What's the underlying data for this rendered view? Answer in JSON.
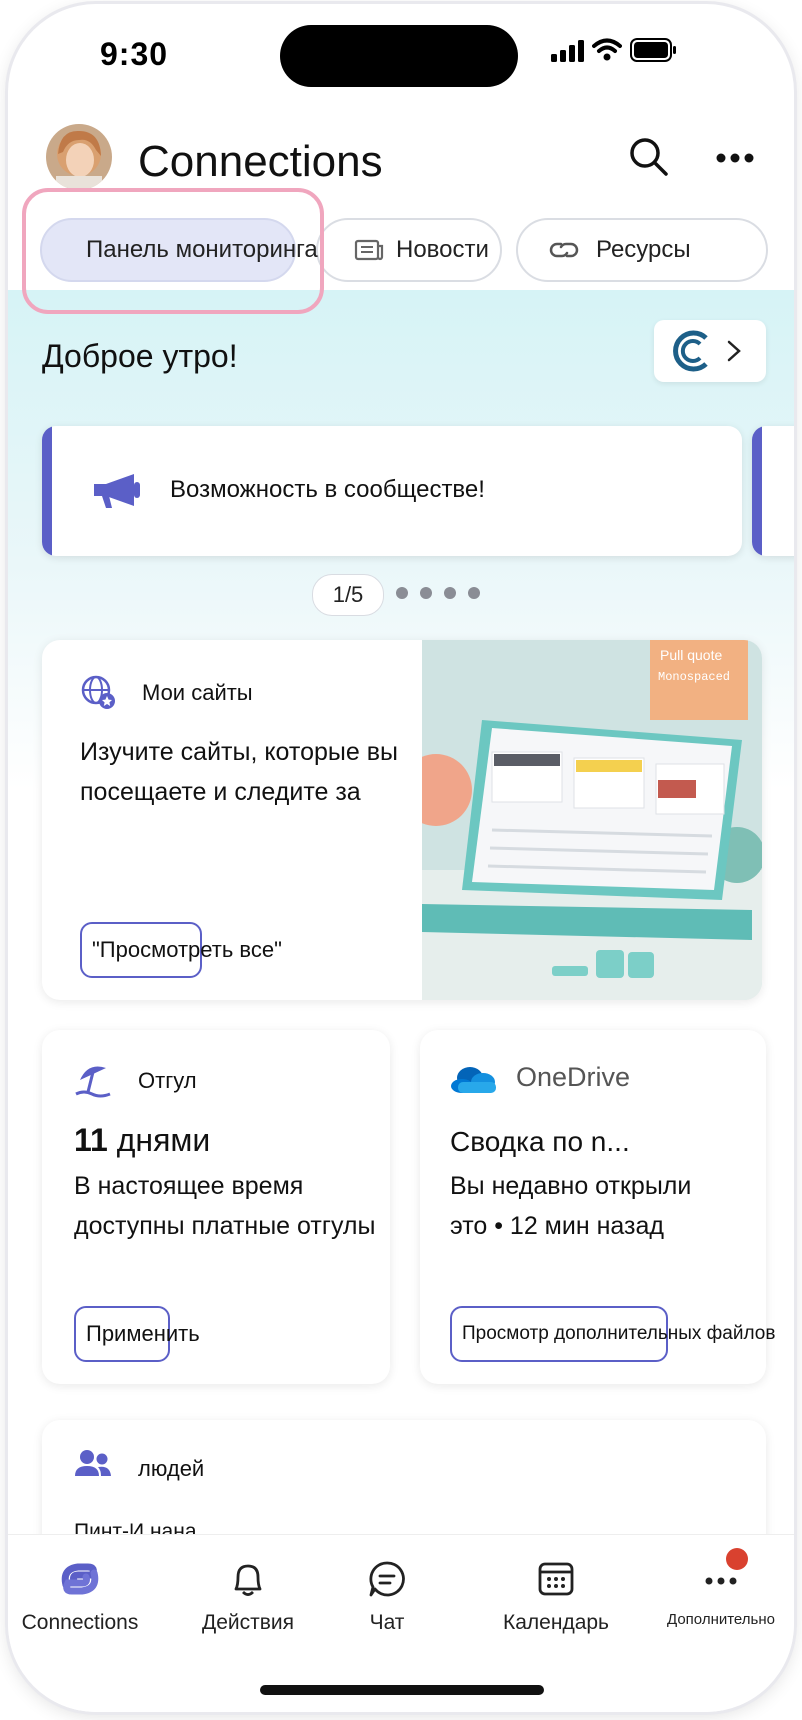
{
  "status_bar": {
    "time": "9:30"
  },
  "header": {
    "app_title": "Connections"
  },
  "tabs": [
    {
      "label": "Панель мониторинга",
      "active": true
    },
    {
      "label": "Новости",
      "active": false
    },
    {
      "label": "Ресурсы",
      "active": false
    }
  ],
  "greeting": "Доброе утро!",
  "announcement": {
    "text": "Возможность в сообществе!",
    "pager": "1/5",
    "accent": "#5b5fc7"
  },
  "my_sites": {
    "title": "Мои сайты",
    "description": "Изучите сайты, которые вы посещаете и следите за",
    "button": "\"Просмотреть все\"",
    "image_labels": {
      "pull_quote": "Pull quote",
      "monospaced": "Monospaced"
    }
  },
  "time_off": {
    "title": "Отгул",
    "count": "11",
    "unit": "днями",
    "description": "В настоящее время доступны платные отгулы",
    "button": "Применить"
  },
  "onedrive": {
    "title": "OneDrive",
    "heading": "Сводка по n...",
    "description": "Вы недавно открыли это • 12 мин назад",
    "button": "Просмотр дополнительных файлов"
  },
  "people": {
    "title": "людей",
    "subtitle": "Пинт-И нана"
  },
  "bottom_nav": [
    {
      "label": "Connections",
      "icon": "connections-logo-icon",
      "active": true
    },
    {
      "label": "Действия",
      "icon": "bell-icon"
    },
    {
      "label": "Чат",
      "icon": "chat-icon"
    },
    {
      "label": "Календарь",
      "icon": "calendar-icon"
    },
    {
      "label": "Дополнительно",
      "icon": "more-icon",
      "badge": true
    }
  ],
  "colors": {
    "accent": "#5b5fc7",
    "highlight": "#f0a6be",
    "badge": "#d9412f"
  }
}
